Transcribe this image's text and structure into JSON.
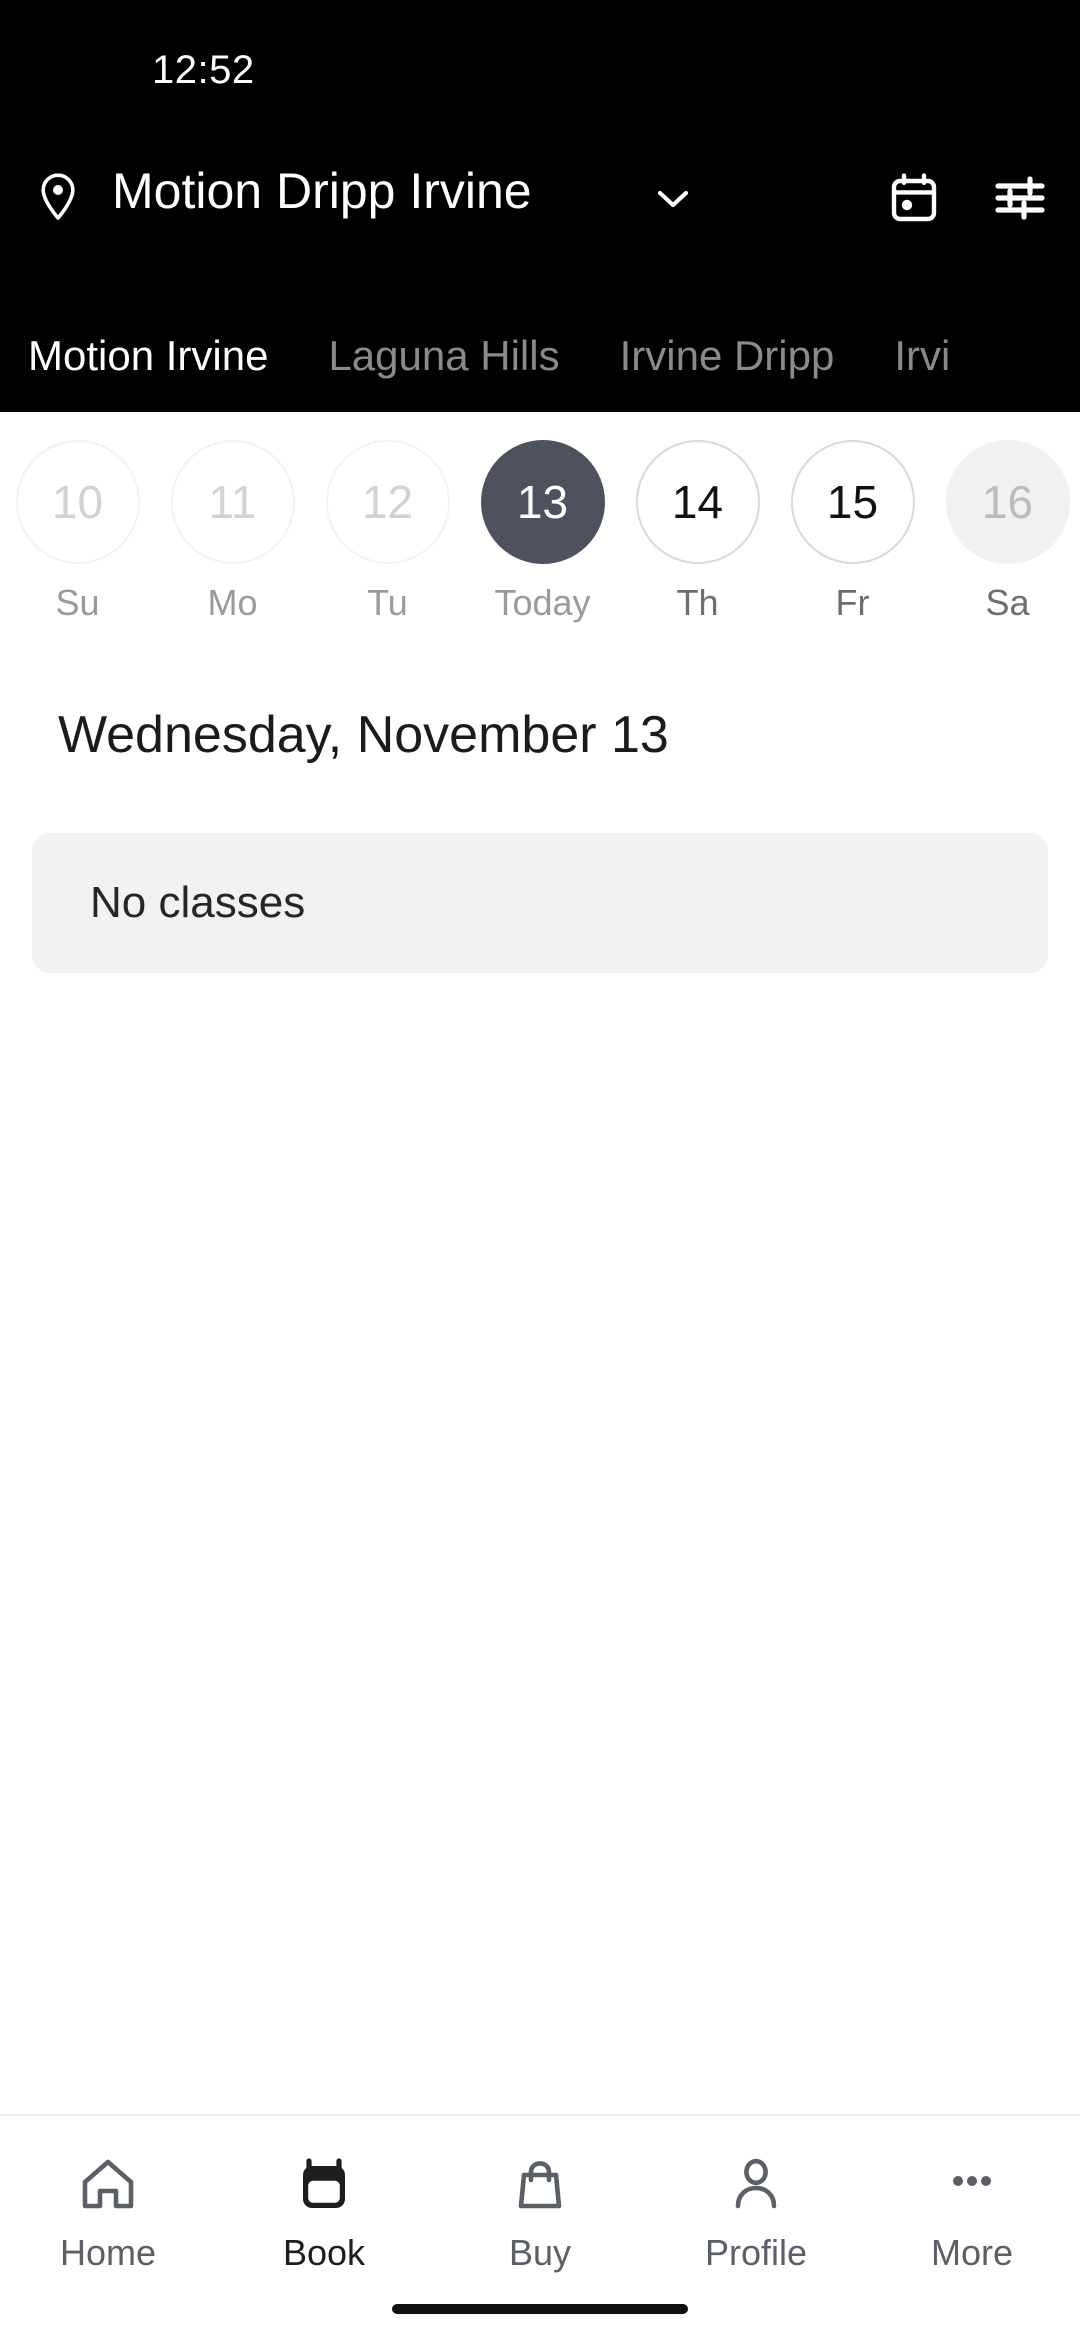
{
  "status_bar": {
    "time": "12:52"
  },
  "header": {
    "pin_icon": "location-pin-icon",
    "location_title": "Motion Dripp Irvine",
    "chevron_icon": "chevron-down-icon",
    "actions": [
      {
        "icon": "calendar-icon",
        "name": "calendar-button"
      },
      {
        "icon": "filter-sliders-icon",
        "name": "filter-button"
      }
    ]
  },
  "location_tabs": {
    "active_index": 0,
    "items": [
      {
        "label": "Motion Irvine"
      },
      {
        "label": "Laguna Hills"
      },
      {
        "label": "Irvine Dripp"
      },
      {
        "label": "Irvi"
      }
    ]
  },
  "date_strip": {
    "selected_index": 3,
    "days": [
      {
        "number": "10",
        "label": "Su",
        "state": "past"
      },
      {
        "number": "11",
        "label": "Mo",
        "state": "past"
      },
      {
        "number": "12",
        "label": "Tu",
        "state": "past"
      },
      {
        "number": "13",
        "label": "Today",
        "state": "today"
      },
      {
        "number": "14",
        "label": "Th",
        "state": "future"
      },
      {
        "number": "15",
        "label": "Fr",
        "state": "future"
      },
      {
        "number": "16",
        "label": "Sa",
        "state": "weekend"
      }
    ]
  },
  "main": {
    "day_heading": "Wednesday, November 13",
    "empty_state": "No classes"
  },
  "bottom_nav": {
    "active_index": 1,
    "items": [
      {
        "label": "Home",
        "icon": "home-icon"
      },
      {
        "label": "Book",
        "icon": "calendar-filled-icon"
      },
      {
        "label": "Buy",
        "icon": "shopping-bag-icon"
      },
      {
        "label": "Profile",
        "icon": "person-icon"
      },
      {
        "label": "More",
        "icon": "three-dots-icon"
      }
    ]
  },
  "colors": {
    "header_bg": "#000000",
    "selected_day": "#4e525c",
    "card_bg": "#f2f2f2",
    "weekend_bg": "#f1f1f1"
  }
}
